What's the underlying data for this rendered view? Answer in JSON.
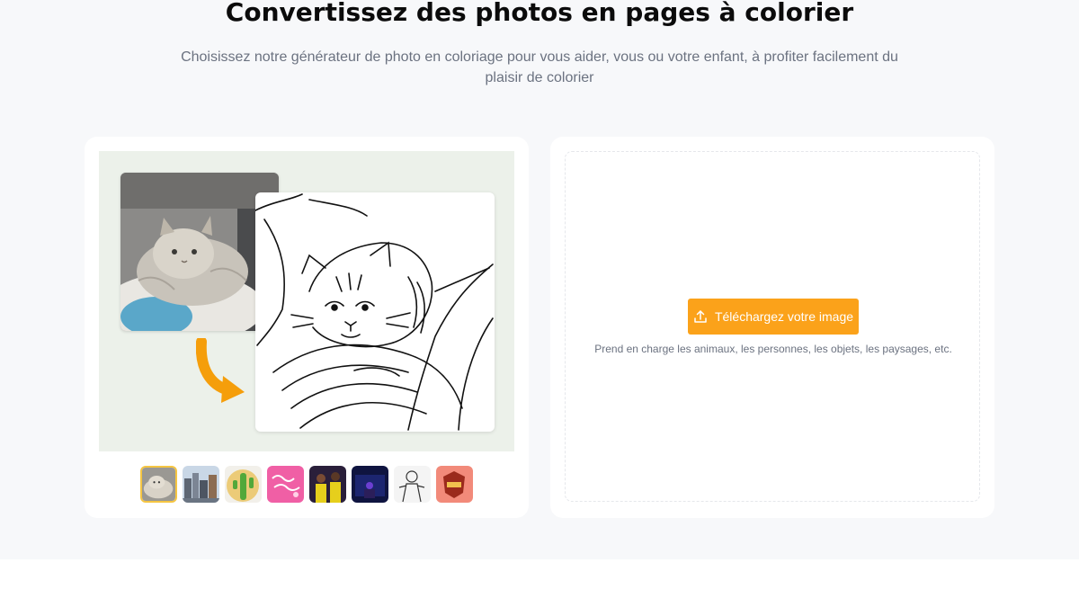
{
  "header": {
    "title": "Convertissez des photos en pages à colorier",
    "subtitle": "Choisissez notre générateur de photo en coloriage pour vous aider, vous ou votre enfant, à profiter facilement du plaisir de colorier"
  },
  "preview": {
    "arrow_color": "#f59e0b",
    "background_color": "#ecf1ea"
  },
  "thumbnails": [
    {
      "name": "cat",
      "selected": true
    },
    {
      "name": "city-skyline",
      "selected": false
    },
    {
      "name": "cactus",
      "selected": false
    },
    {
      "name": "pink-text",
      "selected": false
    },
    {
      "name": "people-yellow",
      "selected": false
    },
    {
      "name": "night-scene",
      "selected": false
    },
    {
      "name": "sketch-figure",
      "selected": false
    },
    {
      "name": "badge-emblem",
      "selected": false
    }
  ],
  "upload": {
    "button_label": "Téléchargez votre image",
    "support_text": "Prend en charge les animaux, les personnes, les objets, les paysages, etc.",
    "accent_color": "#fba21a"
  }
}
